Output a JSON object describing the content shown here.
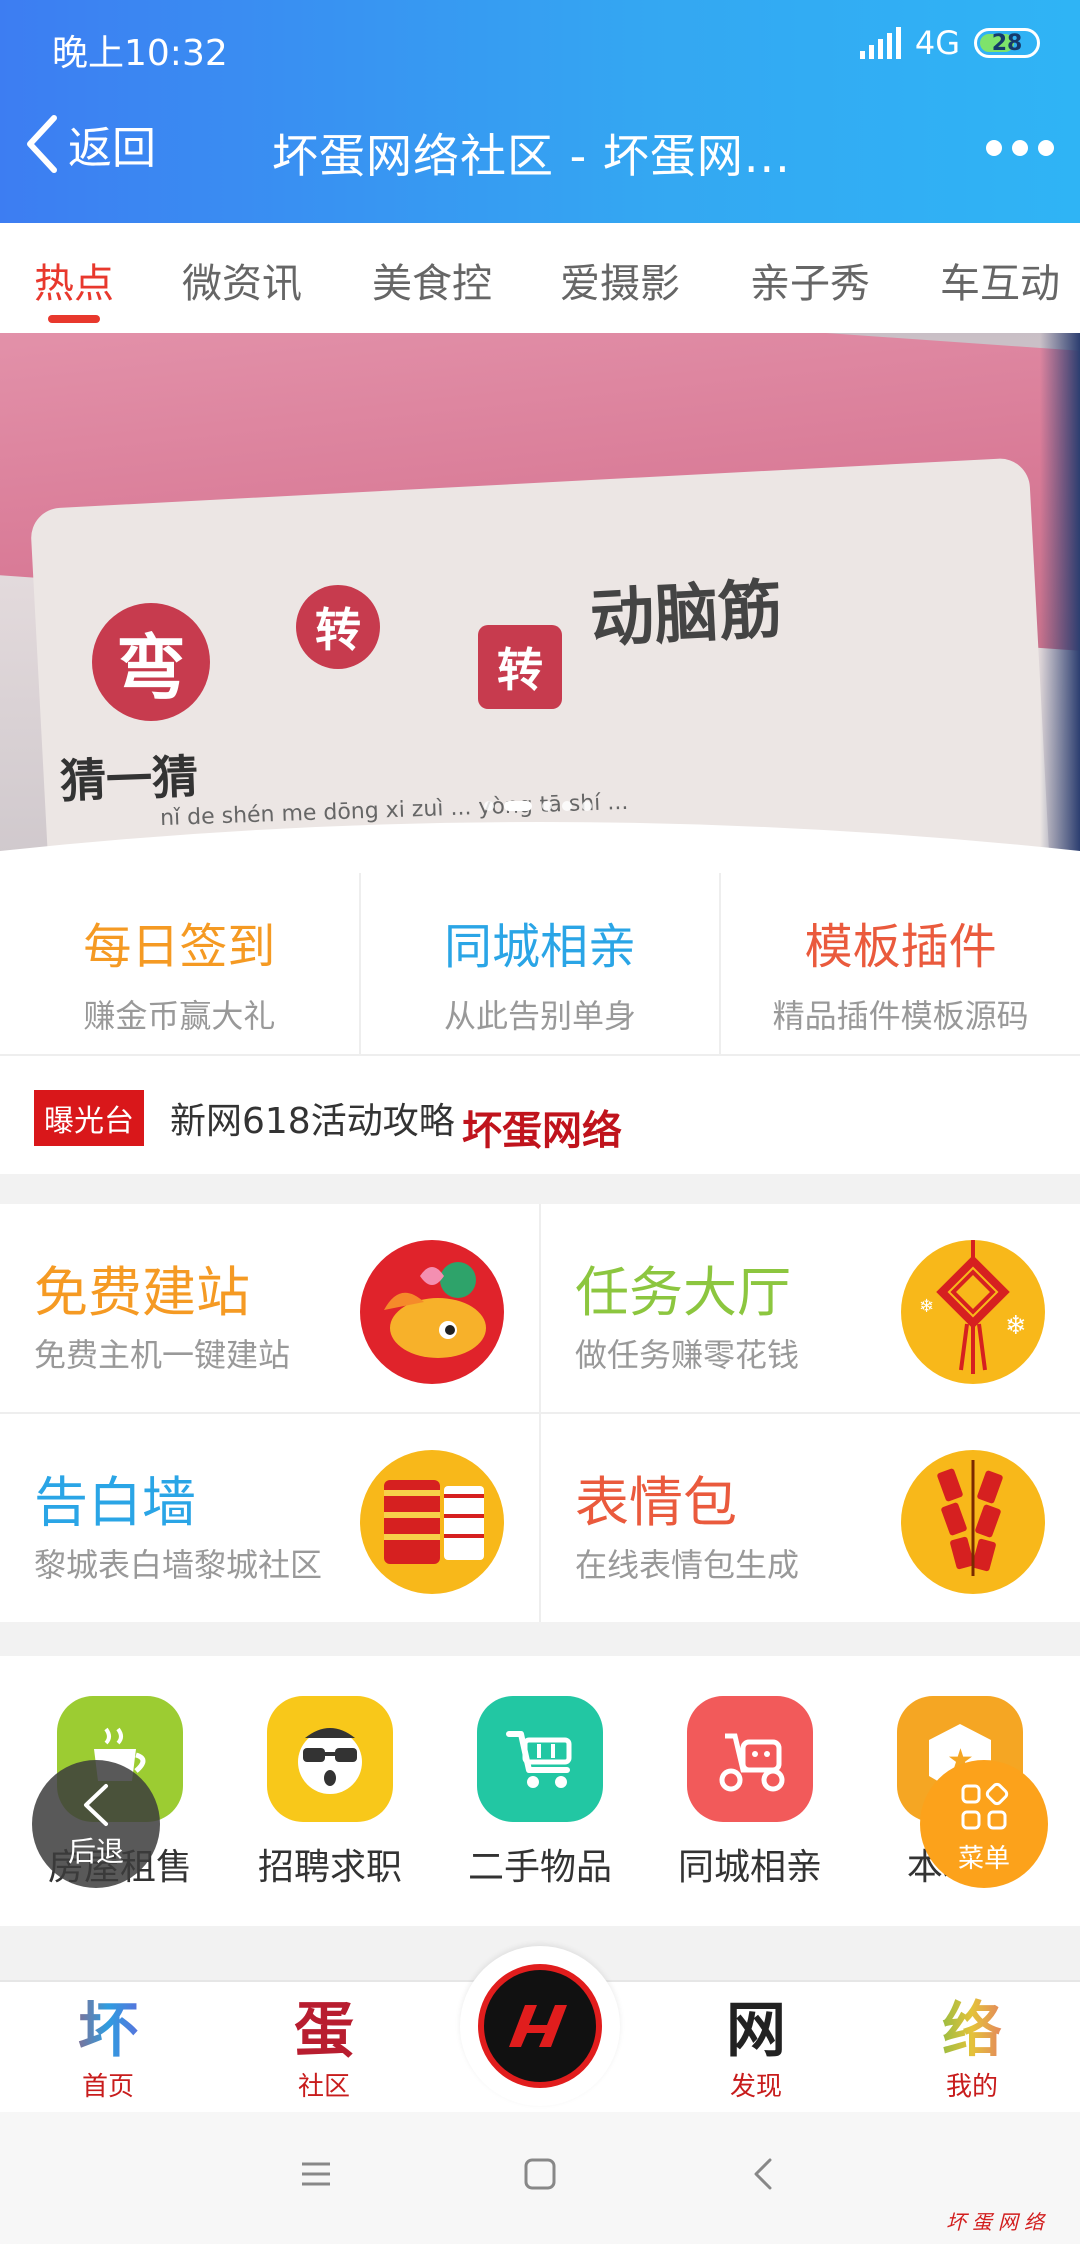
{
  "status_bar": {
    "time": "晚上10:32",
    "network": "4G",
    "battery": "28"
  },
  "header": {
    "back_label": "返回",
    "title": "坏蛋网络社区 - 坏蛋网..."
  },
  "tabs": [
    "热点",
    "微资讯",
    "美食控",
    "爱摄影",
    "亲子秀",
    "车互动"
  ],
  "banner": {
    "headline": "动脑筋",
    "guess": "猜一猜",
    "seals": [
      "弯",
      "转",
      "转"
    ],
    "pinyin": "nǐ de shén me dōng xi zuì ... yòng tā shí ... ",
    "slide_count": 5,
    "active_slide": 2
  },
  "quick_links": [
    {
      "title": "每日签到",
      "subtitle": "赚金币赢大礼",
      "color": "#f59a23"
    },
    {
      "title": "同城相亲",
      "subtitle": "从此告别单身",
      "color": "#2aa5e6"
    },
    {
      "title": "模板插件",
      "subtitle": "精品插件模板源码",
      "color": "#ea5a3d"
    }
  ],
  "notice": {
    "badge": "曝光台",
    "text": "新网618活动攻略",
    "brand": "坏蛋网络"
  },
  "features": [
    {
      "title": "免费建站",
      "subtitle": "免费主机一键建站",
      "color": "#f59a23",
      "icon": "koi-fish-icon"
    },
    {
      "title": "任务大厅",
      "subtitle": "做任务赚零花钱",
      "color": "#8cc63f",
      "icon": "chinese-knot-icon"
    },
    {
      "title": "告白墙",
      "subtitle": "黎城表白墙黎城社区",
      "color": "#2aa5e6",
      "icon": "lantern-icon"
    },
    {
      "title": "表情包",
      "subtitle": "在线表情包生成",
      "color": "#ea5a3d",
      "icon": "firecracker-icon"
    }
  ],
  "apps": [
    {
      "label": "房屋租售",
      "icon": "cup-icon",
      "color": "#9ccc32"
    },
    {
      "label": "招聘求职",
      "icon": "face-icon",
      "color": "#f8c81a"
    },
    {
      "label": "二手物品",
      "icon": "cart-icon",
      "color": "#22c7a3"
    },
    {
      "label": "同城相亲",
      "icon": "scooter-icon",
      "color": "#f25a5a"
    },
    {
      "label": "本地...",
      "icon": "badge-icon",
      "color": "#f5a623"
    }
  ],
  "fab": {
    "back": "后退",
    "menu": "菜单"
  },
  "bottom_nav": [
    {
      "glyph": "坏",
      "label": "首页"
    },
    {
      "glyph": "蛋",
      "label": "社区"
    },
    {
      "glyph": "网",
      "label": "发现"
    },
    {
      "glyph": "络",
      "label": "我的"
    }
  ],
  "watermark": "坏蛋网络"
}
